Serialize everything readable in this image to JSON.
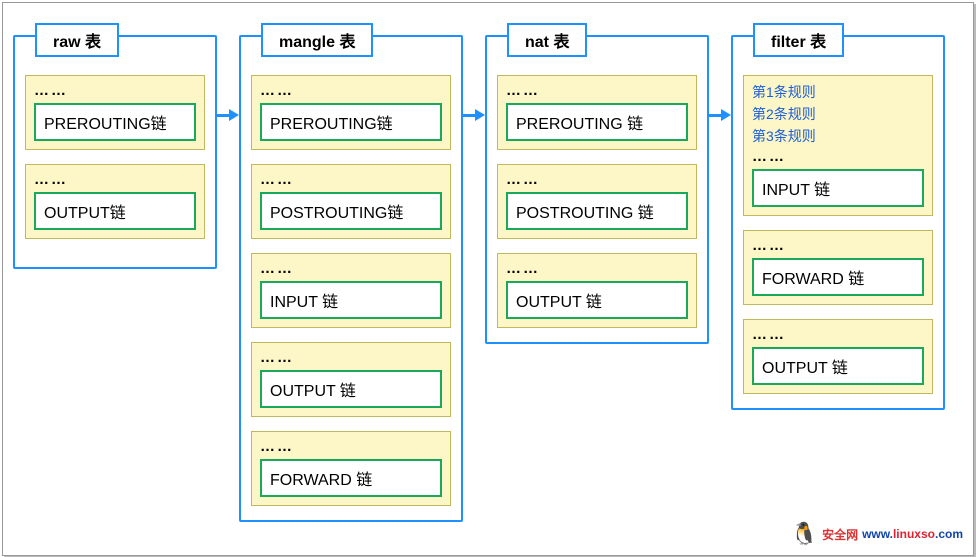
{
  "tables": [
    {
      "title": "raw 表",
      "chains": [
        {
          "prefix": [
            "……"
          ],
          "name": "PREROUTING链"
        },
        {
          "prefix": [
            "……"
          ],
          "name": "OUTPUT链"
        }
      ]
    },
    {
      "title": "mangle 表",
      "chains": [
        {
          "prefix": [
            "……"
          ],
          "name": "PREROUTING链"
        },
        {
          "prefix": [
            "……"
          ],
          "name": "POSTROUTING链"
        },
        {
          "prefix": [
            "……"
          ],
          "name": "INPUT 链"
        },
        {
          "prefix": [
            "……"
          ],
          "name": "OUTPUT 链"
        },
        {
          "prefix": [
            "……"
          ],
          "name": "FORWARD 链"
        }
      ]
    },
    {
      "title": "nat 表",
      "chains": [
        {
          "prefix": [
            "……"
          ],
          "name": "PREROUTING 链"
        },
        {
          "prefix": [
            "……"
          ],
          "name": "POSTROUTING 链"
        },
        {
          "prefix": [
            "……"
          ],
          "name": "OUTPUT 链"
        }
      ]
    },
    {
      "title": "filter 表",
      "chains": [
        {
          "prefix": [
            "第1条规则",
            "第2条规则",
            "第3条规则",
            "……"
          ],
          "name": "INPUT 链",
          "rules": true
        },
        {
          "prefix": [
            "……"
          ],
          "name": "FORWARD 链"
        },
        {
          "prefix": [
            "……"
          ],
          "name": "OUTPUT 链"
        }
      ]
    }
  ],
  "watermark": {
    "brand": "安全网",
    "prefix": "www.",
    "domain": "linuxso",
    "suffix": ".com"
  }
}
